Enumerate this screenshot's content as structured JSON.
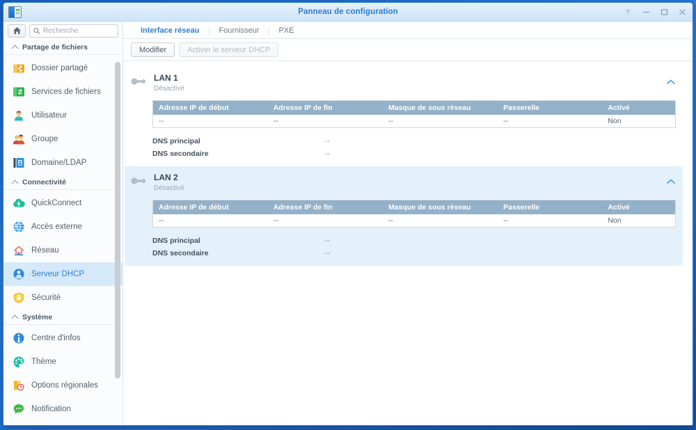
{
  "window": {
    "title": "Panneau de configuration",
    "app_icon": "control-panel-icon",
    "controls": [
      {
        "name": "help-button",
        "glyph": "?"
      },
      {
        "name": "minimize-button",
        "glyph": "–"
      },
      {
        "name": "maximize-button",
        "glyph": "□"
      },
      {
        "name": "close-button",
        "glyph": "×"
      }
    ]
  },
  "sidebar": {
    "home_icon": "home-icon",
    "search": {
      "icon": "search-icon",
      "value": "",
      "placeholder": "Recherche"
    },
    "groups": [
      {
        "label": "Partage de fichiers",
        "icon": "chevron-up-icon",
        "items": [
          {
            "label": "Dossier partagé",
            "icon": "shared-folder-icon",
            "selected": false
          },
          {
            "label": "Services de fichiers",
            "icon": "file-services-icon",
            "selected": false
          },
          {
            "label": "Utilisateur",
            "icon": "user-icon",
            "selected": false
          },
          {
            "label": "Groupe",
            "icon": "group-icon",
            "selected": false
          },
          {
            "label": "Domaine/LDAP",
            "icon": "domain-ldap-icon",
            "selected": false
          }
        ]
      },
      {
        "label": "Connectivité",
        "icon": "chevron-up-icon",
        "items": [
          {
            "label": "QuickConnect",
            "icon": "quickconnect-icon",
            "selected": false
          },
          {
            "label": "Accès externe",
            "icon": "external-access-icon",
            "selected": false
          },
          {
            "label": "Réseau",
            "icon": "network-icon",
            "selected": false
          },
          {
            "label": "Serveur DHCP",
            "icon": "dhcp-server-icon",
            "selected": true
          },
          {
            "label": "Sécurité",
            "icon": "security-icon",
            "selected": false
          }
        ]
      },
      {
        "label": "Système",
        "icon": "chevron-up-icon",
        "items": [
          {
            "label": "Centre d'infos",
            "icon": "info-center-icon",
            "selected": false
          },
          {
            "label": "Thème",
            "icon": "theme-icon",
            "selected": false
          },
          {
            "label": "Options régionales",
            "icon": "regional-options-icon",
            "selected": false
          },
          {
            "label": "Notification",
            "icon": "notification-icon",
            "selected": false
          }
        ]
      }
    ]
  },
  "main": {
    "tabs": [
      {
        "label": "Interface réseau",
        "active": true
      },
      {
        "label": "Fournisseur",
        "active": false
      },
      {
        "label": "PXE",
        "active": false
      }
    ],
    "toolbar": {
      "edit_label": "Modifier",
      "enable_dhcp_label": "Activer le serveur DHCP",
      "enable_dhcp_disabled": true
    },
    "table_headers": [
      "Adresse IP de début",
      "Adresse IP de fin",
      "Masque de sous réseau",
      "Passerelle",
      "Activé"
    ],
    "dns_labels": {
      "primary": "DNS principal",
      "secondary": "DNS secondaire"
    },
    "interfaces": [
      {
        "name": "LAN 1",
        "status": "Désactivé",
        "toggle_icon": "toggle-off-icon",
        "collapse_icon": "chevron-up-icon",
        "selected": false,
        "row": [
          "--",
          "--",
          "--",
          "--",
          "Non"
        ],
        "dns_primary": "--",
        "dns_secondary": "--"
      },
      {
        "name": "LAN 2",
        "status": "Désactivé",
        "toggle_icon": "toggle-off-icon",
        "collapse_icon": "chevron-up-icon",
        "selected": true,
        "row": [
          "--",
          "--",
          "--",
          "--",
          "Non"
        ],
        "dns_primary": "--",
        "dns_secondary": "--"
      }
    ]
  },
  "colors": {
    "accent": "#2f7fd1",
    "title": "#2b7cd3",
    "table_header_bg": "#93b1c8",
    "selected_row_bg": "#e4f1fb",
    "sidebar_selected_bg": "#d6e9fb",
    "desktop_bg": "#1f6ed6"
  }
}
